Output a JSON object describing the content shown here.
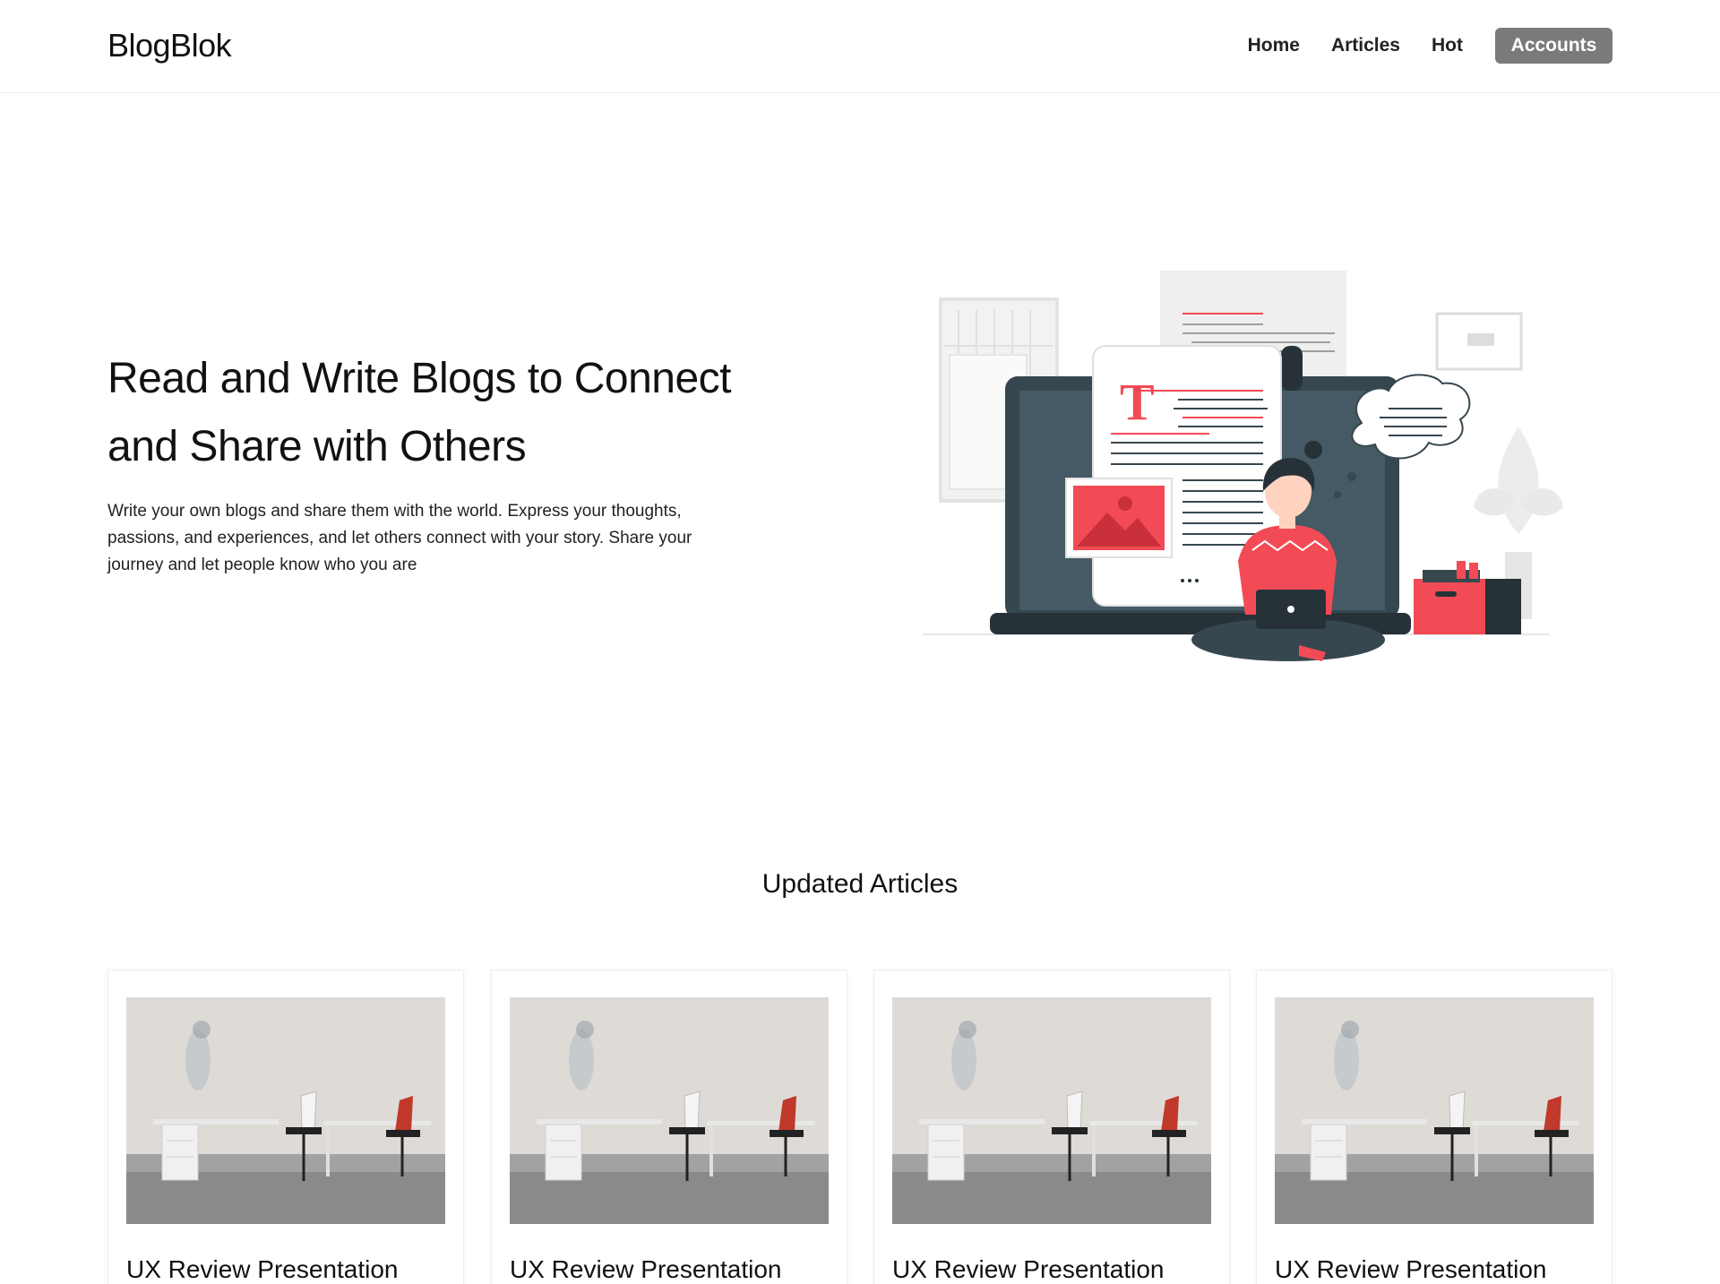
{
  "header": {
    "logo": "BlogBlok",
    "nav": [
      {
        "label": "Home"
      },
      {
        "label": "Articles"
      },
      {
        "label": "Hot"
      }
    ],
    "accounts_label": "Accounts"
  },
  "hero": {
    "title_line1": "Read and Write Blogs to Connect",
    "title_line2": "and Share with Others",
    "description": "Write your own blogs and share them with the world. Express your thoughts, passions, and experiences, and let others connect with your story. Share your journey and let people know who you are",
    "illustration": "blogging-illustration"
  },
  "updated": {
    "title": "Updated Articles",
    "cards": [
      {
        "title": "UX Review Presentation",
        "image": "office-photo"
      },
      {
        "title": "UX Review Presentation",
        "image": "office-photo"
      },
      {
        "title": "UX Review Presentation",
        "image": "office-photo"
      },
      {
        "title": "UX Review Presentation",
        "image": "office-photo"
      }
    ]
  },
  "colors": {
    "accent": "#f24b55",
    "dark": "#37474f",
    "button": "#7a7a7a"
  }
}
